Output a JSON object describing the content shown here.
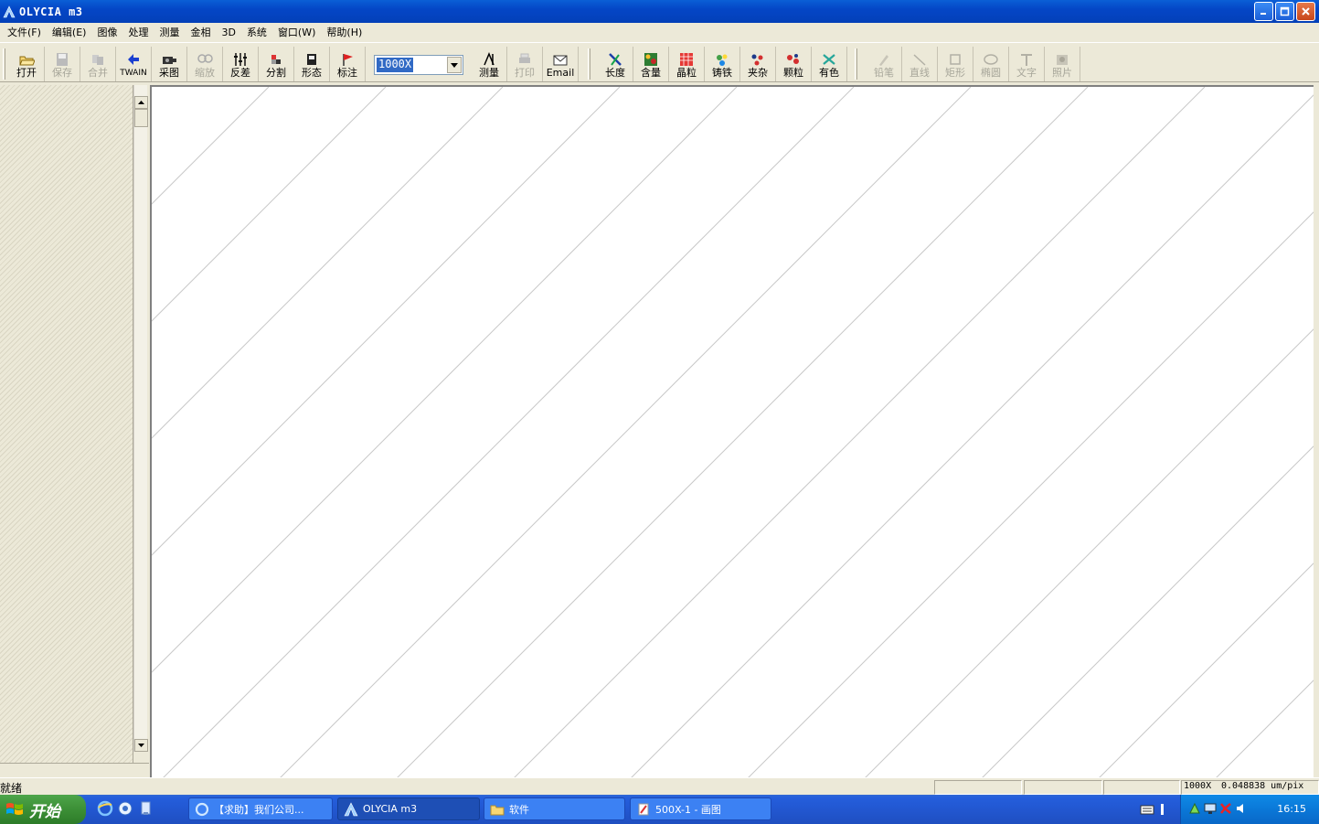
{
  "window": {
    "title": "OLYCIA m3"
  },
  "menu": [
    "文件(F)",
    "编辑(E)",
    "图像",
    "处理",
    "测量",
    "金相",
    "3D",
    "系统",
    "窗口(W)",
    "帮助(H)"
  ],
  "toolbar": {
    "group1": [
      {
        "label": "打开",
        "icon": "open-folder-icon",
        "enabled": true
      },
      {
        "label": "保存",
        "icon": "save-icon",
        "enabled": false
      },
      {
        "label": "合并",
        "icon": "merge-icon",
        "enabled": false
      },
      {
        "label": "TWAIN",
        "icon": "twain-icon",
        "enabled": true
      },
      {
        "label": "采图",
        "icon": "camera-icon",
        "enabled": true
      },
      {
        "label": "缩放",
        "icon": "zoom-icon",
        "enabled": false
      },
      {
        "label": "反差",
        "icon": "contrast-icon",
        "enabled": true
      },
      {
        "label": "分割",
        "icon": "segment-icon",
        "enabled": true
      },
      {
        "label": "形态",
        "icon": "morphology-icon",
        "enabled": true
      },
      {
        "label": "标注",
        "icon": "flag-icon",
        "enabled": true
      }
    ],
    "zoom_value": "1000X",
    "group2": [
      {
        "label": "测量",
        "icon": "measure-icon",
        "enabled": true
      },
      {
        "label": "打印",
        "icon": "print-icon",
        "enabled": false
      },
      {
        "label": "Email",
        "icon": "email-icon",
        "enabled": true
      }
    ],
    "group3": [
      {
        "label": "长度",
        "icon": "length-icon",
        "enabled": true
      },
      {
        "label": "含量",
        "icon": "content-icon",
        "enabled": true
      },
      {
        "label": "晶粒",
        "icon": "grain-icon",
        "enabled": true
      },
      {
        "label": "铸铁",
        "icon": "cast-iron-icon",
        "enabled": true
      },
      {
        "label": "夹杂",
        "icon": "inclusion-icon",
        "enabled": true
      },
      {
        "label": "颗粒",
        "icon": "particle-icon",
        "enabled": true
      },
      {
        "label": "有色",
        "icon": "nonferrous-icon",
        "enabled": true
      }
    ],
    "group4": [
      {
        "label": "铅笔",
        "icon": "pencil-icon",
        "enabled": false
      },
      {
        "label": "直线",
        "icon": "line-icon",
        "enabled": false
      },
      {
        "label": "矩形",
        "icon": "rectangle-icon",
        "enabled": false
      },
      {
        "label": "椭圆",
        "icon": "ellipse-icon",
        "enabled": false
      },
      {
        "label": "文字",
        "icon": "text-icon",
        "enabled": false
      },
      {
        "label": "照片",
        "icon": "photo-icon",
        "enabled": false
      }
    ]
  },
  "status": {
    "text": "就绪",
    "zoom": "1000X",
    "scale": "0.048838 um/pix"
  },
  "taskbar": {
    "start": "开始",
    "tasks": [
      {
        "label": "【求助】我们公司...",
        "icon": "ie-icon",
        "active": false
      },
      {
        "label": "OLYCIA m3",
        "icon": "olycia-icon",
        "active": true
      },
      {
        "label": "软件",
        "icon": "folder-icon",
        "active": false
      },
      {
        "label": "500X-1 - 画图",
        "icon": "paint-icon",
        "active": false
      }
    ],
    "clock": "16:15"
  },
  "colors": {
    "titlebar": "#0446c6",
    "face": "#ece9d8",
    "taskbar": "#245edc",
    "start": "#3c8f36"
  }
}
